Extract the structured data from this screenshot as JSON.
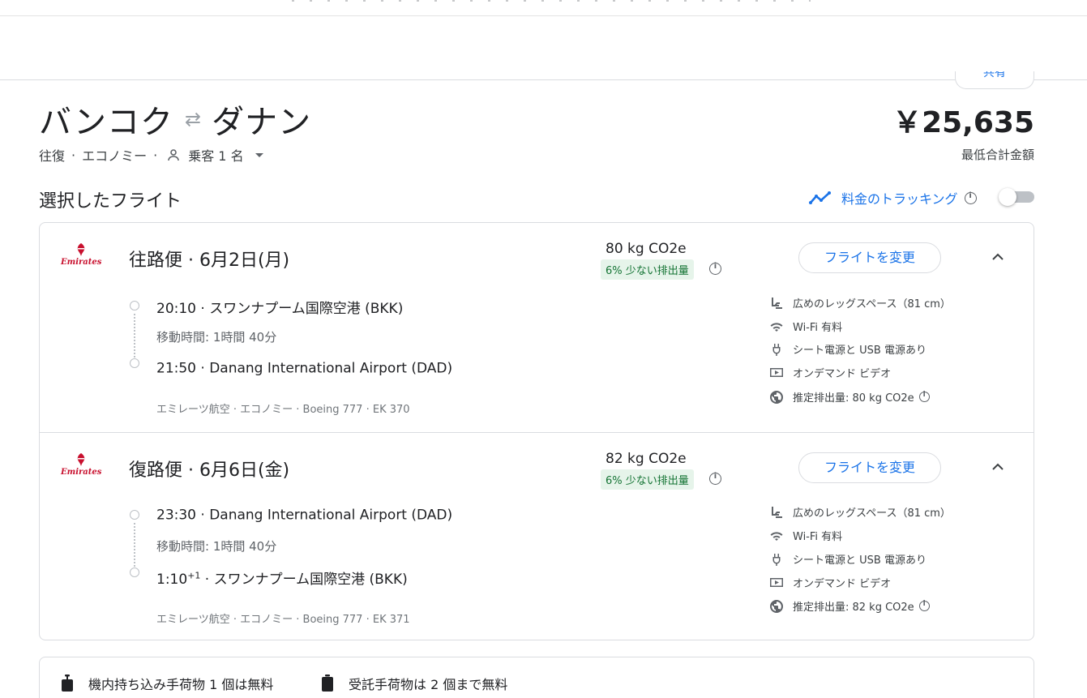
{
  "share": {
    "label": "共有"
  },
  "route": {
    "origin": "バンコク",
    "destination": "ダナン",
    "swap_glyph": "⇄"
  },
  "price": {
    "amount": "￥25,635",
    "label": "最低合計金額"
  },
  "trip": {
    "type": "往復",
    "sep1": "·",
    "cabin": "エコノミー",
    "sep2": "·",
    "passengers": "乗客 1 名"
  },
  "selected_title": "選択したフライト",
  "tracking": {
    "label": "料金のトラッキング",
    "enabled": false
  },
  "legs": [
    {
      "logo_text": "Emirates",
      "title": "往路便 · 6月2日(月)",
      "co2": "80 kg CO2e",
      "co2_badge": "6% 少ない排出量",
      "change_label": "フライトを変更",
      "depart_time": "20:10",
      "depart_sup": "",
      "depart_airport": " · スワンナプーム国際空港 (BKK)",
      "duration": "移動時間: 1時間 40分",
      "arrive_time": "21:50",
      "arrive_sup": "",
      "arrive_airport": " · Danang International Airport (DAD)",
      "detail": "エミレーツ航空 · エコノミー · Boeing 777 · EK 370",
      "amenities": [
        "広めのレッグスペース（81 cm）",
        "Wi-Fi 有料",
        "シート電源と USB 電源あり",
        "オンデマンド ビデオ",
        "推定排出量: 80 kg CO2e"
      ]
    },
    {
      "logo_text": "Emirates",
      "title": "復路便 · 6月6日(金)",
      "co2": "82 kg CO2e",
      "co2_badge": "6% 少ない排出量",
      "change_label": "フライトを変更",
      "depart_time": "23:30",
      "depart_sup": "",
      "depart_airport": " · Danang International Airport (DAD)",
      "duration": "移動時間: 1時間 40分",
      "arrive_time": "1:10",
      "arrive_sup": "+1",
      "arrive_airport": " · スワンナプーム国際空港 (BKK)",
      "detail": "エミレーツ航空 · エコノミー · Boeing 777 · EK 371",
      "amenities": [
        "広めのレッグスペース（81 cm）",
        "Wi-Fi 有料",
        "シート電源と USB 電源あり",
        "オンデマンド ビデオ",
        "推定排出量: 82 kg CO2e"
      ]
    }
  ],
  "baggage": {
    "carry_on": "機内持ち込み手荷物 1 個は無料",
    "checked": "受託手荷物は 2 個まで無料"
  },
  "colors": {
    "accent": "#1a73e8",
    "badge_bg": "#e6f4ea",
    "badge_text": "#137333",
    "brand_red": "#c8102e"
  }
}
